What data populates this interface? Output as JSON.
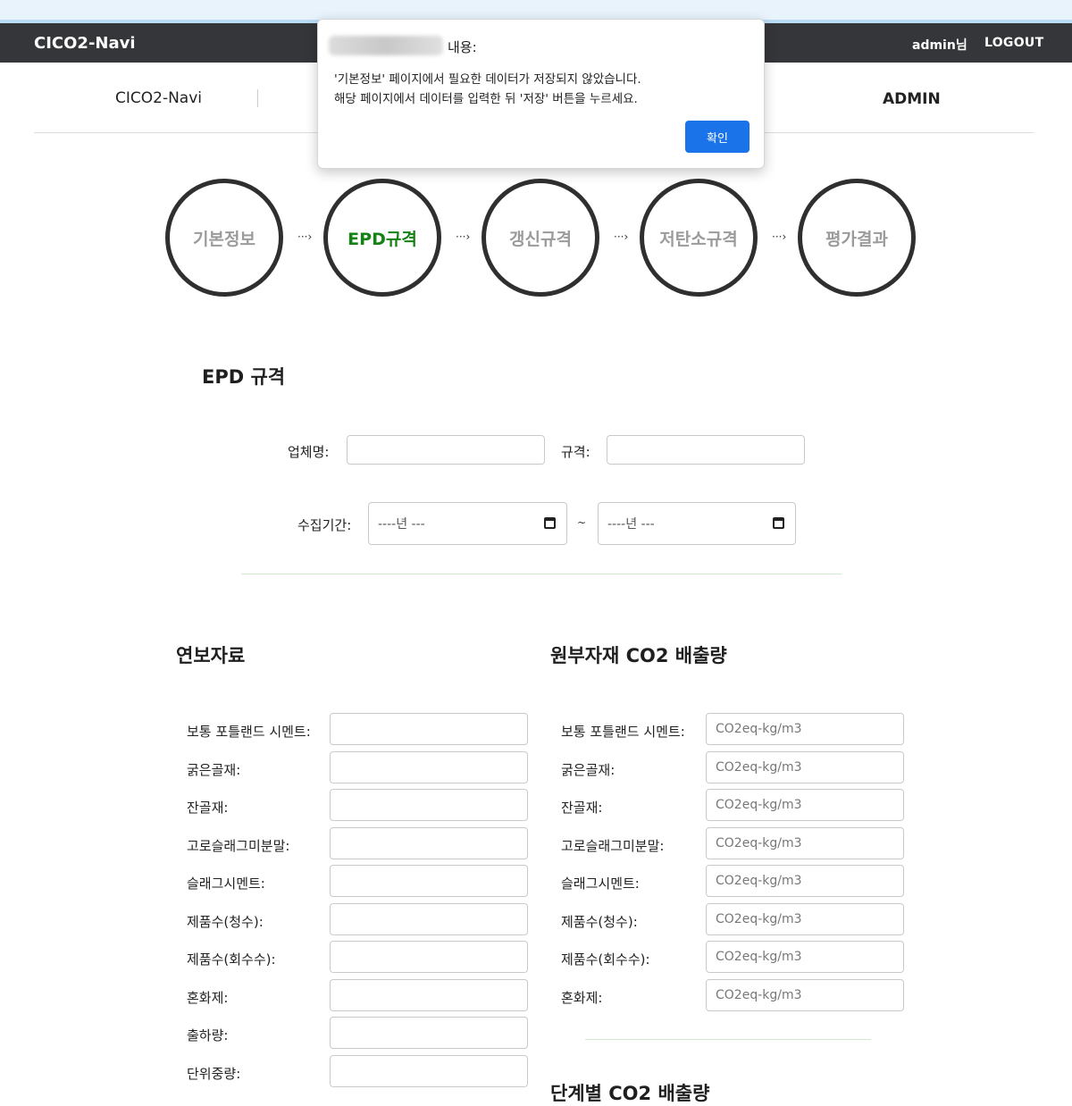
{
  "header": {
    "brand": "CICO2-Navi",
    "user": "admin님",
    "logout": "LOGOUT"
  },
  "subnav": {
    "brand": "CICO2-Navi",
    "admin": "ADMIN"
  },
  "steps": [
    {
      "label": "기본정보",
      "active": false
    },
    {
      "label": "EPD규격",
      "active": true
    },
    {
      "label": "갱신규격",
      "active": false
    },
    {
      "label": "저탄소규격",
      "active": false
    },
    {
      "label": "평가결과",
      "active": false
    }
  ],
  "step_arrow": "···›",
  "epd": {
    "title": "EPD 규격",
    "company_label": "업체명:",
    "spec_label": "규격:",
    "period_label": "수집기간:",
    "date_placeholder": "----년 ---",
    "tilde": "~"
  },
  "annual": {
    "title": "연보자료",
    "rows": [
      "보통 포틀랜드 시멘트:",
      "굵은골재:",
      "잔골재:",
      "고로슬래그미분말:",
      "슬래그시멘트:",
      "제품수(청수):",
      "제품수(회수수):",
      "혼화제:",
      "출하량:",
      "단위중량:"
    ]
  },
  "co2": {
    "title": "원부자재 CO2 배출량",
    "placeholder": "CO2eq-kg/m3",
    "rows": [
      "보통 포틀랜드 시멘트:",
      "굵은골재:",
      "잔골재:",
      "고로슬래그미분말:",
      "슬래그시멘트:",
      "제품수(청수):",
      "제품수(회수수):",
      "혼화제:"
    ],
    "next_title": "단계별 CO2 배출량"
  },
  "dialog": {
    "title": "내용:",
    "line1": "'기본정보' 페이지에서 필요한 데이터가 저장되지 않았습니다.",
    "line2": "해당 페이지에서 데이터를 입력한 뒤 '저장' 버튼을 누르세요.",
    "ok": "확인"
  },
  "colors": {
    "active_step": "#148214",
    "inactive_step": "#9b9b9b",
    "header_bg": "#35363a",
    "ok_button": "#1a73e8"
  }
}
